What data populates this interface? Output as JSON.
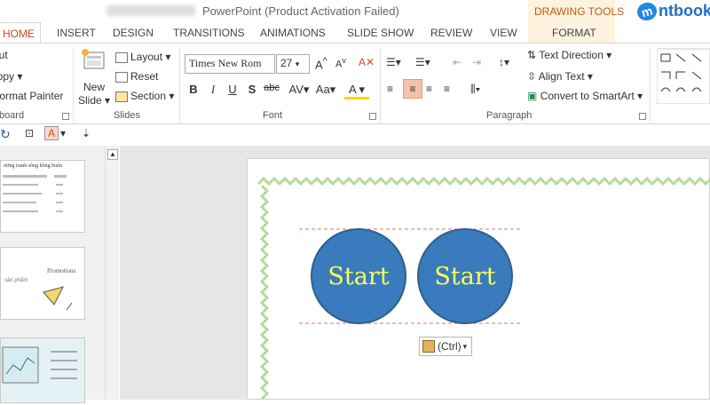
{
  "titlebar": {
    "title": "PowerPoint (Product Activation Failed)",
    "drawing_tools": "DRAWING TOOLS",
    "logo_text": "ntbook",
    "logo_mark": "m"
  },
  "tabs": [
    "HOME",
    "INSERT",
    "DESIGN",
    "TRANSITIONS",
    "ANIMATIONS",
    "SLIDE SHOW",
    "REVIEW",
    "VIEW",
    "FORMAT"
  ],
  "ribbon": {
    "clipboard": {
      "cut": "Cut",
      "copy": "Copy",
      "format_painter": "Format Painter",
      "label": "Clipboard"
    },
    "slides": {
      "new_slide": "New",
      "new_slide2": "Slide",
      "layout": "Layout",
      "reset": "Reset",
      "section": "Section",
      "label": "Slides"
    },
    "font": {
      "font_name": "Times New Rom",
      "font_size": "27",
      "label": "Font"
    },
    "paragraph": {
      "label": "Paragraph",
      "text_direction": "Text Direction",
      "align_text": "Align Text",
      "convert_smartart": "Convert to SmartArt"
    }
  },
  "slide": {
    "circle1": "Start",
    "circle2": "Start"
  },
  "paste_options": "(Ctrl)",
  "colors": {
    "accent": "#d24726",
    "circle": "#3a7bbd",
    "circle_text": "#ffff55",
    "drawing_tools": "#c55a11"
  },
  "thumbnails": [
    {
      "title": "ương tranh sông hồng buôn"
    },
    {
      "title": "Promotions",
      "subtitle": "sản phẩm"
    },
    {
      "title": ""
    }
  ]
}
